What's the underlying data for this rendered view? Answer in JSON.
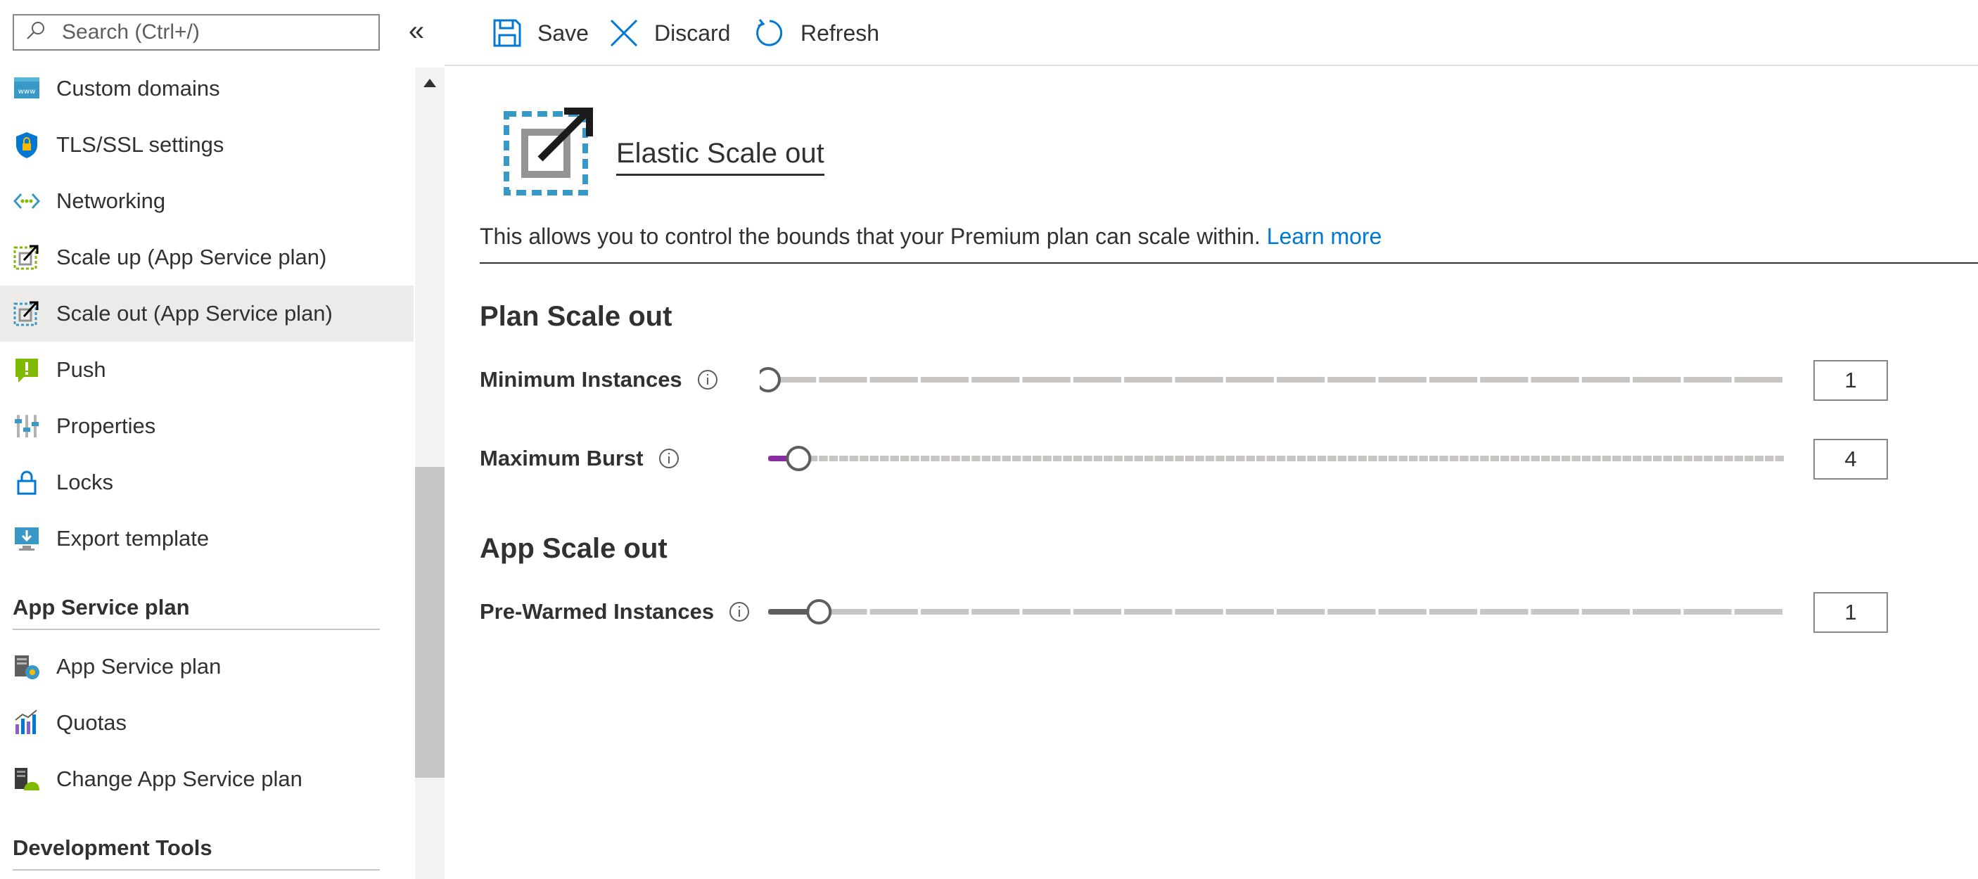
{
  "search": {
    "placeholder": "Search (Ctrl+/)"
  },
  "sidebar": {
    "items": [
      {
        "label": "Custom domains",
        "icon": "www-icon"
      },
      {
        "label": "TLS/SSL settings",
        "icon": "shield-lock-icon"
      },
      {
        "label": "Networking",
        "icon": "networking-icon"
      },
      {
        "label": "Scale up (App Service plan)",
        "icon": "scale-up-icon"
      },
      {
        "label": "Scale out (App Service plan)",
        "icon": "scale-out-icon",
        "active": true
      },
      {
        "label": "Push",
        "icon": "push-icon"
      },
      {
        "label": "Properties",
        "icon": "properties-icon"
      },
      {
        "label": "Locks",
        "icon": "lock-icon"
      },
      {
        "label": "Export template",
        "icon": "export-template-icon"
      }
    ],
    "section_app_service_plan": "App Service plan",
    "plan_items": [
      {
        "label": "App Service plan",
        "icon": "app-service-plan-icon"
      },
      {
        "label": "Quotas",
        "icon": "quotas-icon"
      },
      {
        "label": "Change App Service plan",
        "icon": "change-plan-icon"
      }
    ],
    "section_dev_tools": "Development Tools"
  },
  "toolbar": {
    "save_label": "Save",
    "discard_label": "Discard",
    "refresh_label": "Refresh"
  },
  "main": {
    "hero_title": "Elastic Scale out",
    "description": "This allows you to control the bounds that your Premium plan can scale within.",
    "learn_more": "Learn more",
    "plan_section": "Plan Scale out",
    "app_section": "App Scale out",
    "min_instances": {
      "label": "Minimum Instances",
      "value": "1",
      "level": 0.0
    },
    "max_burst": {
      "label": "Maximum Burst",
      "value": "4",
      "level": 0.03
    },
    "prewarmed": {
      "label": "Pre-Warmed Instances",
      "value": "1",
      "level": 0.05
    }
  },
  "colors": {
    "accent": "#0078d4",
    "burst_fill": "#8a2da5",
    "active_bg": "#edebe9"
  }
}
